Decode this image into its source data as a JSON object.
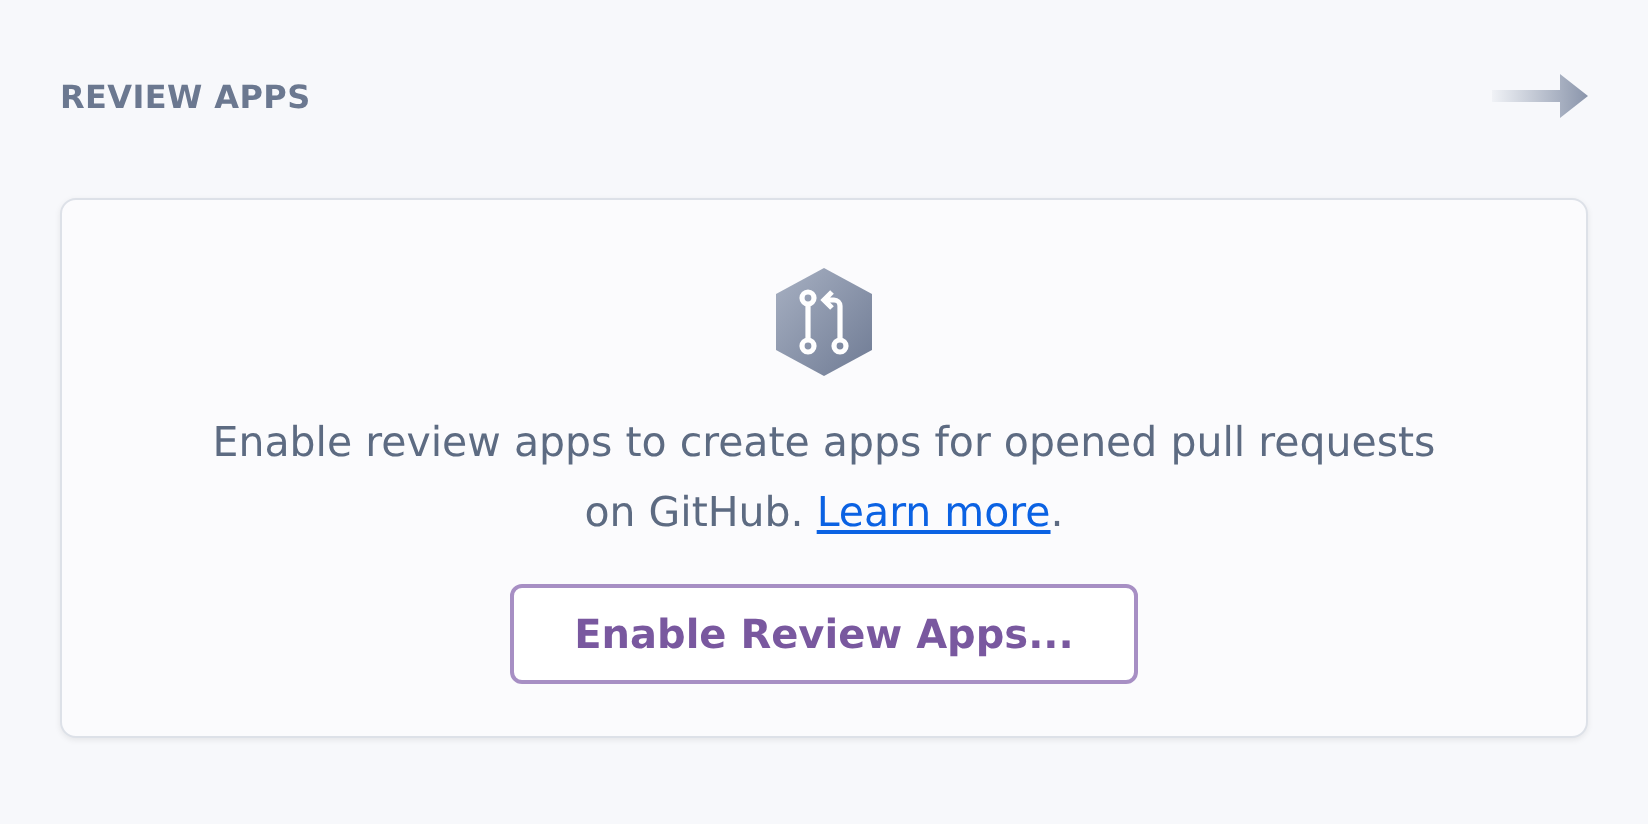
{
  "section": {
    "title": "REVIEW APPS"
  },
  "card": {
    "message": "Enable review apps to create apps for opened pull requests on GitHub.",
    "link": "Learn more",
    "message_end": ".",
    "button": "Enable Review Apps..."
  }
}
